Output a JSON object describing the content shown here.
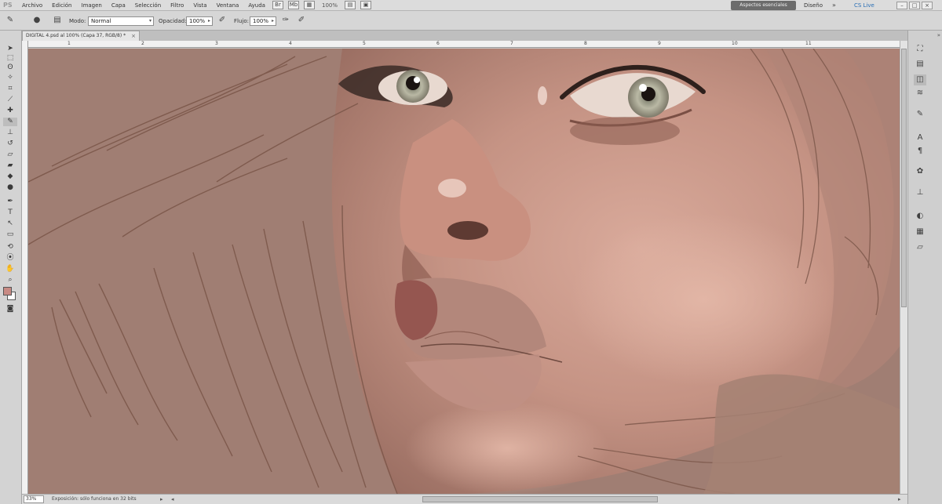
{
  "menubar": {
    "app_logo": "PS",
    "items": [
      "Archivo",
      "Edición",
      "Imagen",
      "Capa",
      "Selección",
      "Filtro",
      "Vista",
      "Ventana",
      "Ayuda"
    ],
    "zoom_display": "100%",
    "workspace_button": "Aspectos esenciales",
    "workspace_label": "Diseño",
    "more_label": "»",
    "cslive_label": "CS Live"
  },
  "options": {
    "mode_label": "Modo:",
    "mode_value": "Normal",
    "opacity_label": "Opacidad:",
    "opacity_value": "100%",
    "flow_label": "Flujo:",
    "flow_value": "100%"
  },
  "document": {
    "tab_title": "DIGITAL 4.psd al 100% (Capa 37, RGB/8) *",
    "close": "×"
  },
  "ruler": {
    "h_marks": [
      "1",
      "2",
      "3",
      "4",
      "5",
      "6",
      "7",
      "8",
      "9",
      "10",
      "11"
    ]
  },
  "status": {
    "zoom": "33%",
    "info": "Exposición: sólo funciona en 32 bits",
    "arrow": "▸",
    "left_arrow": "◂",
    "right_arrow": "▸"
  },
  "colors": {
    "canvas_bg": "#a07e73",
    "foreground": "#c88a84",
    "background": "#ffffff",
    "workspace_button_bg": "#6c6c6c"
  },
  "icons": {
    "tools": [
      "move-icon",
      "marquee-icon",
      "lasso-icon",
      "quick-select-icon",
      "crop-icon",
      "eyedropper-icon",
      "healing-icon",
      "brush-icon",
      "clone-stamp-icon",
      "history-brush-icon",
      "eraser-icon",
      "gradient-icon",
      "blur-icon",
      "dodge-icon",
      "pen-icon",
      "type-icon",
      "path-select-icon",
      "shape-icon",
      "3d-rotate-icon",
      "3d-camera-icon",
      "hand-icon",
      "zoom-icon"
    ],
    "panels": [
      "navigator-icon",
      "histogram-icon",
      "layers-icon",
      "channels-icon",
      "paths-icon",
      "character-icon",
      "paragraph-icon",
      "brush-presets-icon",
      "clone-source-icon",
      "adjustments-icon",
      "masks-icon",
      "styles-icon"
    ]
  }
}
